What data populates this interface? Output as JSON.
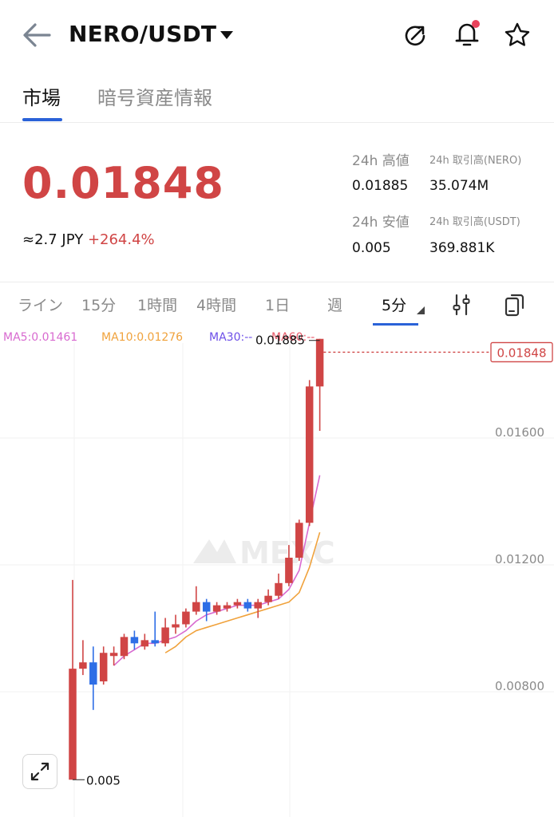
{
  "header": {
    "title": "NERO/USDT",
    "icons": [
      "back-arrow-icon",
      "caret-down-icon",
      "share-icon",
      "bell-icon",
      "star-icon"
    ],
    "notification_dot_color": "#e8425b"
  },
  "tabs": [
    {
      "label": "市場",
      "active": true
    },
    {
      "label": "暗号資産情報",
      "active": false
    }
  ],
  "price": {
    "last": "0.01848",
    "jpy": "≈2.7 JPY",
    "change": "+264.4%",
    "color": "#d04545"
  },
  "stats": {
    "high_label": "24h 高値",
    "high_value": "0.01885",
    "vol_base_label": "24h 取引高(NERO)",
    "vol_base_value": "35.074M",
    "low_label": "24h 安値",
    "low_value": "0.005",
    "vol_quote_label": "24h 取引高(USDT)",
    "vol_quote_value": "369.881K"
  },
  "timeframes": [
    {
      "label": "ライン",
      "active": false
    },
    {
      "label": "15分",
      "active": false
    },
    {
      "label": "1時間",
      "active": false
    },
    {
      "label": "4時間",
      "active": false
    },
    {
      "label": "1日",
      "active": false
    },
    {
      "label": "週",
      "active": false
    },
    {
      "label": "5分",
      "active": true
    }
  ],
  "ma_legend": {
    "ma5": {
      "label": "MA5:0.01461",
      "color": "#d86ad0"
    },
    "ma10": {
      "label": "MA10:0.01276",
      "color": "#f0a23c"
    },
    "ma30": {
      "label": "MA30:--",
      "color": "#6d4fe8"
    },
    "ma60": {
      "label": "MA60:--",
      "color": "#e85a6a"
    }
  },
  "chart_data": {
    "type": "candlestick",
    "y_ticks": [
      "0.01600",
      "0.01200",
      "0.00800"
    ],
    "y_tick_values": [
      0.016,
      0.012,
      0.008
    ],
    "ylim": [
      0.0048,
      0.0193
    ],
    "last_price_label": "0.01848",
    "high_marker_label": "0.01885",
    "low_marker_label": "0.005",
    "colors": {
      "up": "#d04545",
      "down": "#2e6ee6"
    },
    "watermark": "MEXC",
    "candles": [
      {
        "o": 0.005,
        "c": 0.0085,
        "h": 0.0113,
        "l": 0.005
      },
      {
        "o": 0.0085,
        "c": 0.0087,
        "h": 0.0094,
        "l": 0.0083
      },
      {
        "o": 0.0087,
        "c": 0.008,
        "h": 0.0092,
        "l": 0.0072
      },
      {
        "o": 0.0081,
        "c": 0.009,
        "h": 0.0092,
        "l": 0.008
      },
      {
        "o": 0.0089,
        "c": 0.009,
        "h": 0.0092,
        "l": 0.0086
      },
      {
        "o": 0.0089,
        "c": 0.0095,
        "h": 0.0096,
        "l": 0.0088
      },
      {
        "o": 0.0095,
        "c": 0.0093,
        "h": 0.0097,
        "l": 0.0091
      },
      {
        "o": 0.0092,
        "c": 0.0094,
        "h": 0.0096,
        "l": 0.0091
      },
      {
        "o": 0.0094,
        "c": 0.0093,
        "h": 0.0103,
        "l": 0.0092
      },
      {
        "o": 0.0093,
        "c": 0.0098,
        "h": 0.0101,
        "l": 0.0092
      },
      {
        "o": 0.0098,
        "c": 0.0099,
        "h": 0.0102,
        "l": 0.0096
      },
      {
        "o": 0.0099,
        "c": 0.0103,
        "h": 0.0104,
        "l": 0.0098
      },
      {
        "o": 0.0103,
        "c": 0.0106,
        "h": 0.0111,
        "l": 0.0102
      },
      {
        "o": 0.0106,
        "c": 0.0103,
        "h": 0.0107,
        "l": 0.01
      },
      {
        "o": 0.0103,
        "c": 0.0105,
        "h": 0.0106,
        "l": 0.0102
      },
      {
        "o": 0.0104,
        "c": 0.0105,
        "h": 0.0106,
        "l": 0.0103
      },
      {
        "o": 0.0105,
        "c": 0.0106,
        "h": 0.0107,
        "l": 0.0104
      },
      {
        "o": 0.0106,
        "c": 0.0104,
        "h": 0.0107,
        "l": 0.0103
      },
      {
        "o": 0.0104,
        "c": 0.0106,
        "h": 0.0107,
        "l": 0.0101
      },
      {
        "o": 0.0106,
        "c": 0.0108,
        "h": 0.011,
        "l": 0.0105
      },
      {
        "o": 0.0108,
        "c": 0.0112,
        "h": 0.0115,
        "l": 0.0107
      },
      {
        "o": 0.0112,
        "c": 0.012,
        "h": 0.0124,
        "l": 0.0111
      },
      {
        "o": 0.012,
        "c": 0.0131,
        "h": 0.0132,
        "l": 0.0119
      },
      {
        "o": 0.0131,
        "c": 0.0174,
        "h": 0.0176,
        "l": 0.013
      },
      {
        "o": 0.0174,
        "c": 0.0189,
        "h": 0.0189,
        "l": 0.016
      }
    ],
    "ma5": [
      null,
      null,
      null,
      null,
      0.0086,
      0.0089,
      0.0091,
      0.0093,
      0.0093,
      0.0094,
      0.0095,
      0.0097,
      0.01,
      0.0102,
      0.0103,
      0.0104,
      0.0105,
      0.0105,
      0.0105,
      0.0106,
      0.0107,
      0.011,
      0.0116,
      0.0131,
      0.0146
    ],
    "ma10": [
      null,
      null,
      null,
      null,
      null,
      null,
      null,
      null,
      null,
      0.009,
      0.0092,
      0.0095,
      0.0097,
      0.0098,
      0.0099,
      0.01,
      0.0101,
      0.0102,
      0.0103,
      0.0104,
      0.0105,
      0.0106,
      0.0109,
      0.0117,
      0.0128
    ]
  },
  "controls": {
    "expand_icon": "expand-arrows-icon",
    "settings_icon": "sliders-icon",
    "rotate_icon": "rotate-screen-icon"
  }
}
